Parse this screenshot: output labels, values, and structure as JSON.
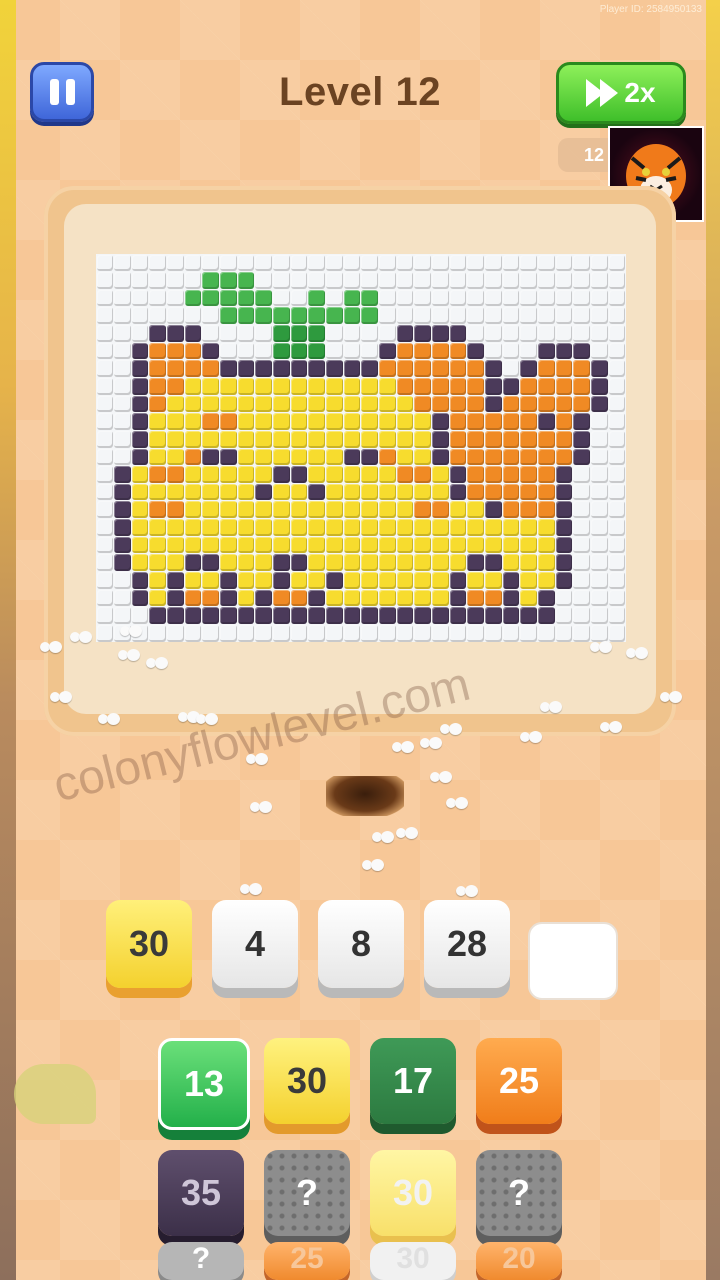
{
  "header": {
    "player_id": "Player ID: 2584950133",
    "level_title": "Level 12",
    "speed_label": "2x",
    "timer_text": "12"
  },
  "watermark": "colonyflowlevel.com",
  "slots": [
    {
      "value": "30",
      "style": "yellow"
    },
    {
      "value": "4",
      "style": "white"
    },
    {
      "value": "8",
      "style": "white"
    },
    {
      "value": "28",
      "style": "white"
    },
    {
      "value": "",
      "style": "empty"
    }
  ],
  "queue": [
    {
      "value": "13",
      "style": "green-light"
    },
    {
      "value": "30",
      "style": "yellow"
    },
    {
      "value": "17",
      "style": "green-dark"
    },
    {
      "value": "25",
      "style": "orange"
    },
    {
      "value": "35",
      "style": "purple"
    },
    {
      "value": "?",
      "style": "mystery"
    },
    {
      "value": "30",
      "style": "yellow-faded"
    },
    {
      "value": "?",
      "style": "mystery"
    },
    {
      "value": "?",
      "style": "mystery-faded"
    },
    {
      "value": "25",
      "style": "orange-faded"
    },
    {
      "value": "30",
      "style": "white-faded"
    },
    {
      "value": "20",
      "style": "orange-faded"
    }
  ],
  "palette": {
    "W": "#f4f6f8",
    "G": "#47b54f",
    "g": "#2e9a3e",
    "O": "#f08a24",
    "Y": "#f7dc2e",
    "P": "#4b3a5a",
    "L": "#ffe873"
  },
  "pixel_rows": [
    "WWWWWWWWWWWWWWWWWWWWWWWWWWWWWW",
    "WWWWWWGGGWWWWWWWWWWWWWWWWWWWWW",
    "WWWWWGGGGGWWGWGGWWWWWWWWWWWWWW",
    "WWWWWWWGGGGGGGGGWWWWWWWWWWWWWW",
    "WWWPPPWWWWgggWWWWPPPPWWWWWWWWW",
    "WWPOOOPWWWgggWWWPOOOOPWWWPPPWW",
    "WWPOOOOPPPPPPPPPOOOOOOPWPOOOPW",
    "WWPOOYYYYYYYYYYYYOOOOOPPOOOOPW",
    "WWPOYYYYYYYYYYYYYYOOOOPOOOOOPW",
    "WWPYYYOOYYYYYYYYYYYPOOOOOPOPWW",
    "WWPYYYYYYYYYYYYYYYYPOOOOOOOPWW",
    "WWPYYOPPYYYYYYPPOYYPOOOOOOOPWW",
    "WPYOOYYYYYPPYYYYYOOYPOOOOOPWWW",
    "WPYYYYYYYPYYPYYYYYYYPOOOOOPWWW",
    "WPYOOYYYYYYYYYYYYYOOYYPOOOPWWW",
    "WPYYYYYYYYYYYYYYYYYYYYYYYYPWWW",
    "WPYYYYYYYYYYYYYYYYYYYYYYYYPWWW",
    "WPYYYPPYYYPPYYYYYYYYYPPYYYPWWW",
    "WWPYPYYPYYPYYPYYYYYYPYYPYYPWWW",
    "WWPYPOOPYPOOPYYYYYYYPOOPYPWWWW",
    "WWWPPPPPPPPPPPPPPPPPPPPPPPWWWW",
    "WWWWWWWWWWWWWWWWWWWWWWWWWWWWWW"
  ]
}
